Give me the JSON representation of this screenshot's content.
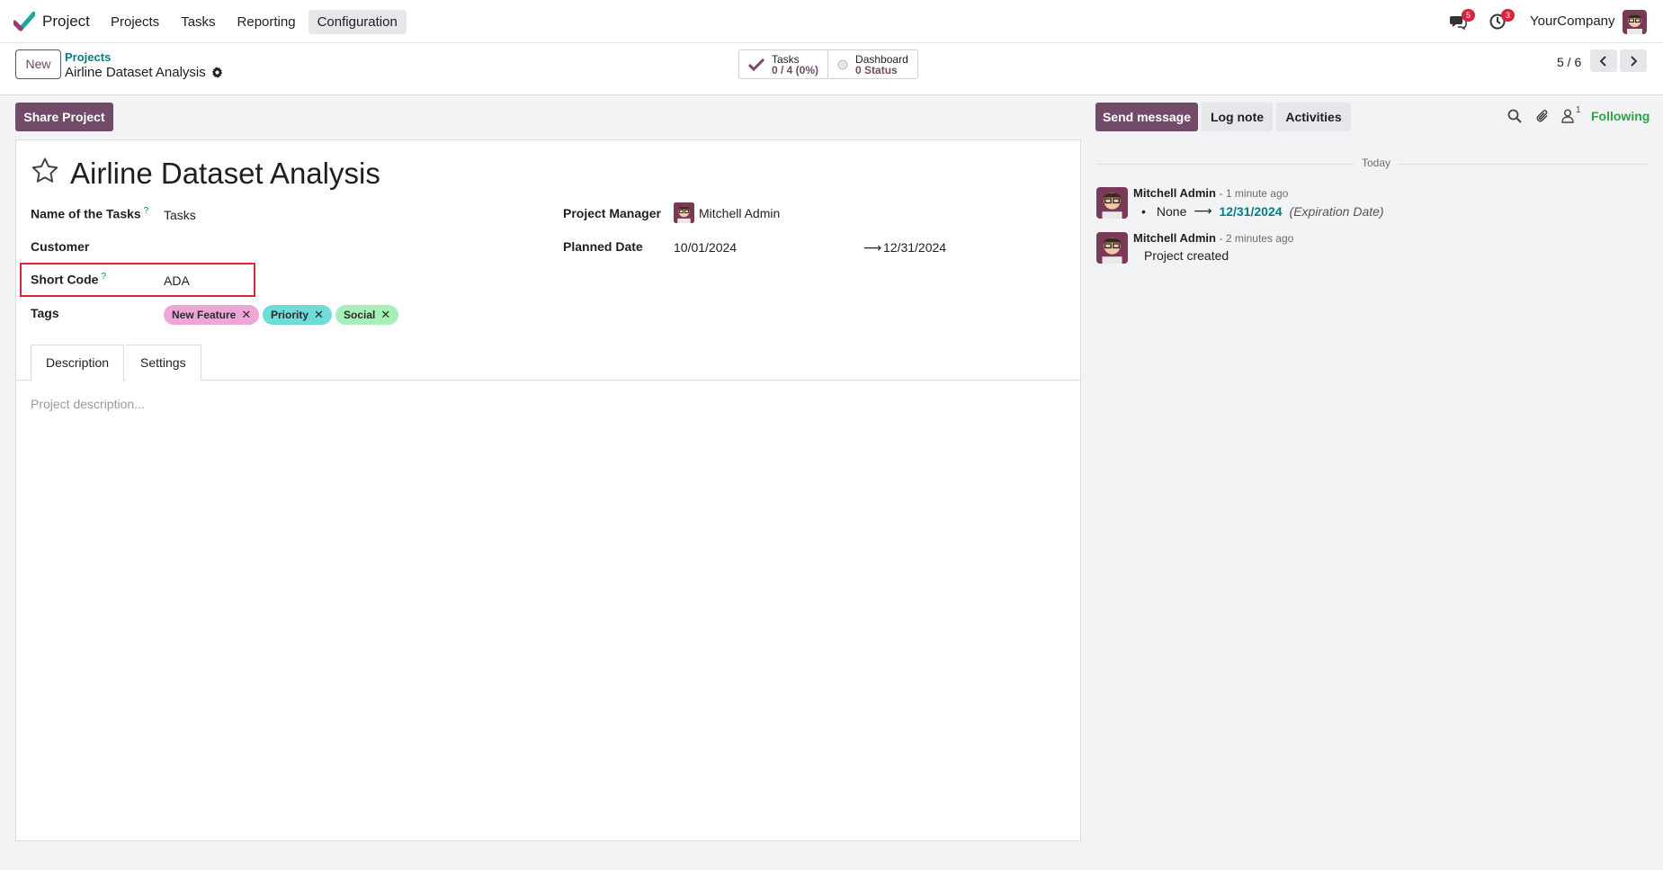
{
  "topbar": {
    "app_name": "Project",
    "menu": [
      "Projects",
      "Tasks",
      "Reporting",
      "Configuration"
    ],
    "active_menu": "Configuration",
    "messages_badge": "5",
    "activities_badge": "3",
    "company": "YourCompany"
  },
  "controlbar": {
    "new_label": "New",
    "breadcrumb_parent": "Projects",
    "breadcrumb_current": "Airline Dataset Analysis",
    "smart_tasks_label": "Tasks",
    "smart_tasks_value": "0 / 4 (0%)",
    "smart_dashboard_label": "Dashboard",
    "smart_dashboard_value": "0 Status",
    "pager": "5 / 6"
  },
  "actions": {
    "share_project": "Share Project",
    "send_message": "Send message",
    "log_note": "Log note",
    "activities": "Activities",
    "followers_count": "1",
    "following": "Following"
  },
  "form": {
    "title": "Airline Dataset Analysis",
    "name_of_tasks_label": "Name of the Tasks",
    "name_of_tasks_value": "Tasks",
    "customer_label": "Customer",
    "short_code_label": "Short Code",
    "short_code_value": "ADA",
    "tags_label": "Tags",
    "tags": [
      {
        "label": "New Feature",
        "color": "#f0a5d8"
      },
      {
        "label": "Priority",
        "color": "#6fdcd8"
      },
      {
        "label": "Social",
        "color": "#a6efb8"
      }
    ],
    "project_manager_label": "Project Manager",
    "project_manager_value": "Mitchell Admin",
    "planned_date_label": "Planned Date",
    "planned_date_start": "10/01/2024",
    "planned_date_end": "12/31/2024",
    "tabs": [
      "Description",
      "Settings"
    ],
    "description_placeholder": "Project description...",
    "help_mark": "?"
  },
  "chatter": {
    "today_label": "Today",
    "messages": [
      {
        "author": "Mitchell Admin",
        "time": "- 1 minute ago",
        "old_value": "None",
        "new_value": "12/31/2024",
        "field": "(Expiration Date)"
      },
      {
        "author": "Mitchell Admin",
        "time": "- 2 minutes ago",
        "body": "Project created"
      }
    ]
  },
  "colors": {
    "brand": "#714b67",
    "link": "#017e84",
    "following": "#28a745",
    "badge": "#d9253a",
    "highlight": "#d9253a"
  }
}
